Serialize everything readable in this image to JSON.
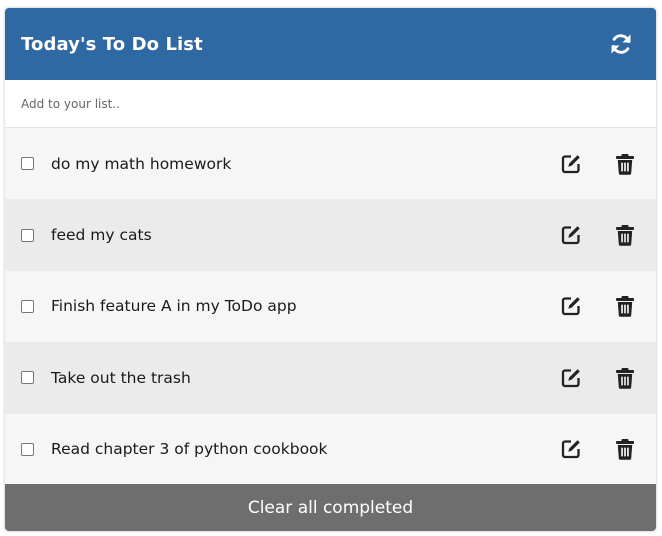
{
  "header": {
    "title": "Today's To Do List",
    "refresh_icon": "refresh-icon",
    "color": "#2f69a3"
  },
  "add_input": {
    "placeholder": "Add to your list.."
  },
  "todos": [
    {
      "text": "do my math homework",
      "completed": false
    },
    {
      "text": "feed my cats",
      "completed": false
    },
    {
      "text": "Finish feature A in my ToDo app",
      "completed": false
    },
    {
      "text": "Take out the trash",
      "completed": false
    },
    {
      "text": "Read chapter 3 of python cookbook",
      "completed": false
    }
  ],
  "item_icons": {
    "edit": "edit-icon",
    "delete": "trash-icon"
  },
  "footer": {
    "clear_label": "Clear all completed",
    "color": "#6e6e6e"
  }
}
